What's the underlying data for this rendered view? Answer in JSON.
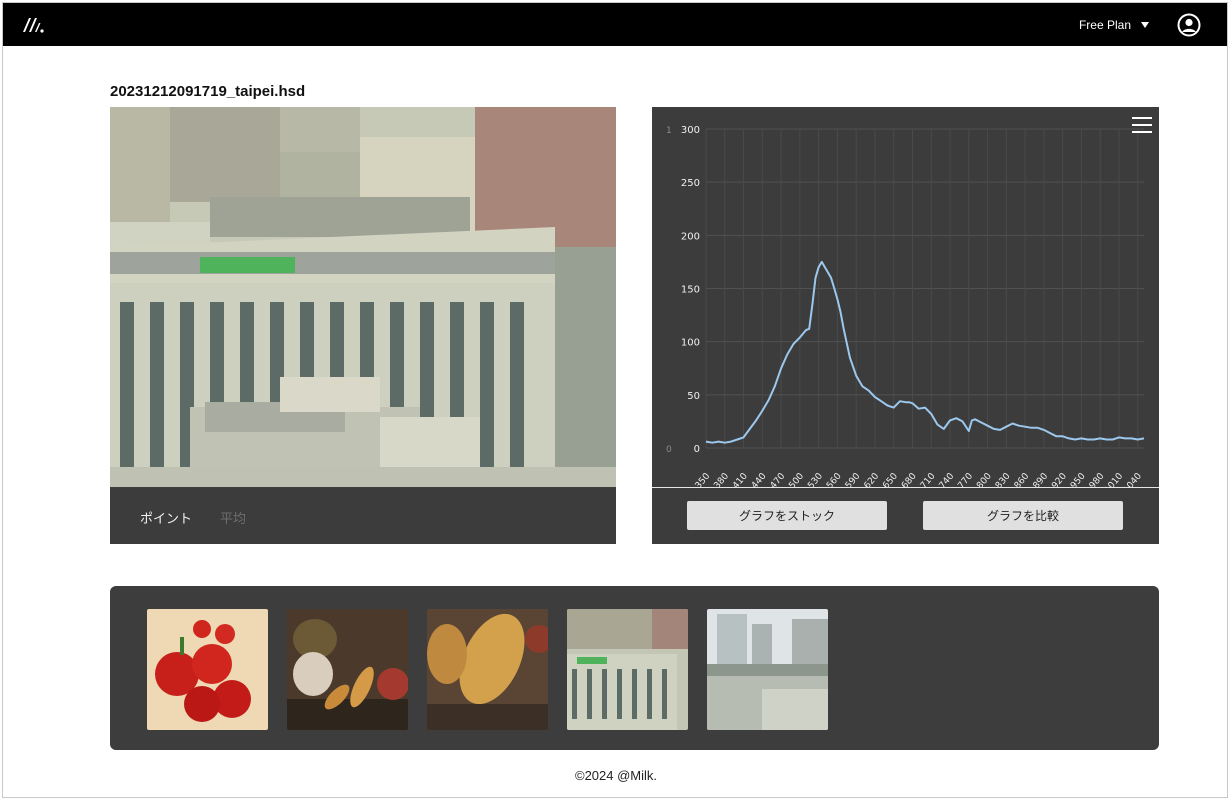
{
  "header": {
    "plan_label": "Free Plan",
    "logo_icon": "brand-logo-icon",
    "caret_icon": "chevron-down-icon",
    "account_icon": "account-circle-icon"
  },
  "file": {
    "name": "20231212091719_taipei.hsd"
  },
  "viewer": {
    "modes": {
      "point": "ポイント",
      "average": "平均"
    }
  },
  "chart_panel": {
    "menu_icon": "hamburger-menu-icon",
    "stack_button": "グラフをストック",
    "compare_button": "グラフを比較"
  },
  "gallery": {
    "items": [
      "red-peppers",
      "still-life-fruits",
      "bananas-closeup",
      "taipei-buildings",
      "city-skyline"
    ]
  },
  "footer": {
    "copyright": "©2024 @Milk."
  },
  "chart_data": {
    "type": "line",
    "title": "",
    "xlabel": "",
    "ylabel": "",
    "corner_label": "1",
    "ylim": [
      0,
      300
    ],
    "yticks": [
      0,
      50,
      100,
      150,
      200,
      250,
      300
    ],
    "xticks": [
      350,
      380,
      410,
      440,
      470,
      500,
      530,
      560,
      590,
      620,
      650,
      680,
      710,
      740,
      770,
      800,
      830,
      860,
      890,
      920,
      950,
      980,
      1010,
      1040
    ],
    "xlim": [
      350,
      1050
    ],
    "grid": true,
    "line_color": "#9cc8ee",
    "series": [
      {
        "x": [
          350,
          360,
          370,
          380,
          390,
          400,
          410,
          420,
          430,
          440,
          450,
          460,
          470,
          480,
          490,
          500,
          510,
          515,
          520,
          525,
          530,
          535,
          540,
          545,
          550,
          555,
          560,
          565,
          570,
          580,
          590,
          600,
          610,
          620,
          630,
          640,
          650,
          660,
          670,
          675,
          680,
          690,
          700,
          710,
          720,
          730,
          740,
          750,
          760,
          770,
          775,
          780,
          790,
          800,
          810,
          820,
          830,
          840,
          850,
          860,
          870,
          880,
          890,
          900,
          910,
          920,
          930,
          940,
          950,
          960,
          970,
          980,
          990,
          1000,
          1010,
          1020,
          1030,
          1040,
          1050
        ],
        "y": [
          6,
          5,
          6,
          5,
          6,
          8,
          10,
          18,
          26,
          35,
          45,
          58,
          75,
          88,
          98,
          104,
          111,
          112,
          135,
          160,
          170,
          175,
          170,
          165,
          160,
          150,
          140,
          128,
          112,
          85,
          68,
          58,
          54,
          48,
          44,
          40,
          38,
          44,
          43,
          43,
          42,
          37,
          38,
          32,
          22,
          18,
          26,
          28,
          25,
          16,
          26,
          27,
          24,
          21,
          18,
          17,
          20,
          23,
          21,
          20,
          19,
          19,
          17,
          14,
          11,
          11,
          9,
          8,
          9,
          8,
          8,
          9,
          8,
          8,
          10,
          9,
          9,
          8,
          9
        ]
      }
    ]
  }
}
